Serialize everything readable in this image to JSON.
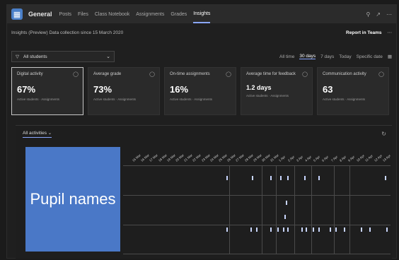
{
  "app": {
    "title": "General"
  },
  "tabs": [
    "Posts",
    "Files",
    "Class Notebook",
    "Assignments",
    "Grades",
    "Insights"
  ],
  "active_tab": "Insights",
  "top_right": [
    "⚲",
    "↗",
    "⋯"
  ],
  "sub": {
    "text": "Insights (Preview)  Data collection since 15 March 2020",
    "report_label": "Report in Teams",
    "more": "⋯"
  },
  "filter": {
    "class_select": "All students",
    "periods": [
      "All time",
      "30 days",
      "7 days",
      "Today",
      "Specific date"
    ],
    "active_period": "30 days"
  },
  "cards": [
    {
      "title": "Digital activity",
      "value": "67%",
      "note": "Active students · Assignments",
      "selected": true
    },
    {
      "title": "Average grade",
      "value": "73%",
      "note": "Active students · Assignments",
      "selected": false
    },
    {
      "title": "On-time assignments",
      "value": "16%",
      "note": "Active students · Assignments",
      "selected": false
    },
    {
      "title": "Average time for feedback",
      "value": "1.2 days",
      "note": "Active students · Assignments",
      "selected": false
    },
    {
      "title": "Communication activity",
      "value": "63",
      "note": "Active students · Assignments",
      "selected": false
    }
  ],
  "grid": {
    "selector": "All activities",
    "names_label": "Pupil names"
  },
  "dates": [
    "15 Mar",
    "16 Mar",
    "17 Mar",
    "18 Mar",
    "19 Mar",
    "20 Mar",
    "21 Mar",
    "22 Mar",
    "23 Mar",
    "24 Mar",
    "25 Mar",
    "26 Mar",
    "27 Mar",
    "28 Mar",
    "29 Mar",
    "30 Mar",
    "31 Mar",
    "1 Apr",
    "2 Apr",
    "3 Apr",
    "4 Apr",
    "5 Apr",
    "6 Apr",
    "7 Apr",
    "8 Apr",
    "9 Apr",
    "10 Apr",
    "11 Apr",
    "12 Apr",
    "13 Apr"
  ]
}
